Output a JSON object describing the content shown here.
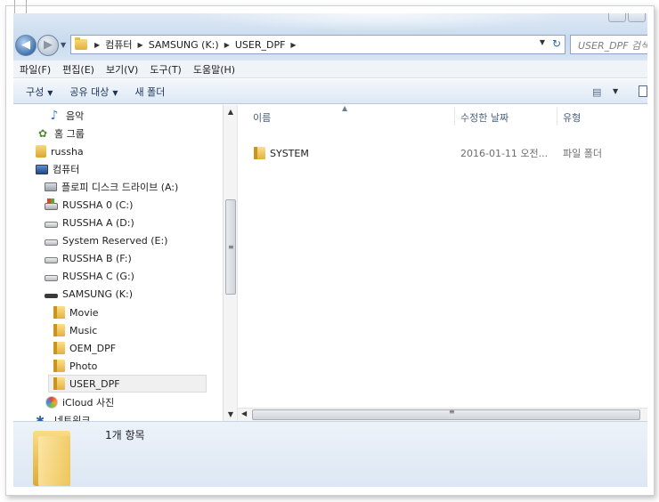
{
  "window": {
    "path": [
      "컴퓨터",
      "SAMSUNG (K:)",
      "USER_DPF"
    ],
    "search_placeholder": "USER_DPF 검색"
  },
  "nav_buttons": {
    "back": "◀",
    "forward": "▶",
    "refresh": "↻"
  },
  "menu": [
    "파일(F)",
    "편집(E)",
    "보기(V)",
    "도구(T)",
    "도움말(H)"
  ],
  "toolbar": {
    "organize": "구성",
    "share": "공유 대상",
    "new_folder": "새 폴더",
    "view_icon": "details-view-icon"
  },
  "nav_tree": [
    {
      "label": "음악",
      "icon": "music-icon"
    },
    {
      "label": "홈 그룹",
      "icon": "homegroup-icon"
    },
    {
      "label": "russha",
      "icon": "user-folder-icon"
    },
    {
      "label": "컴퓨터",
      "icon": "computer-icon"
    },
    {
      "label": "플로피 디스크 드라이브 (A:)",
      "icon": "floppy-drive-icon"
    },
    {
      "label": "RUSSHA 0 (C:)",
      "icon": "windows-drive-icon"
    },
    {
      "label": "RUSSHA A (D:)",
      "icon": "drive-icon"
    },
    {
      "label": "System Reserved (E:)",
      "icon": "drive-icon"
    },
    {
      "label": "RUSSHA B (F:)",
      "icon": "drive-icon"
    },
    {
      "label": "RUSSHA C (G:)",
      "icon": "drive-icon"
    },
    {
      "label": "SAMSUNG (K:)",
      "icon": "usb-drive-icon"
    },
    {
      "label": "Movie",
      "icon": "folder-icon"
    },
    {
      "label": "Music",
      "icon": "folder-icon"
    },
    {
      "label": "OEM_DPF",
      "icon": "folder-icon"
    },
    {
      "label": "Photo",
      "icon": "folder-icon"
    },
    {
      "label": "USER_DPF",
      "icon": "folder-icon",
      "selected": true
    },
    {
      "label": "iCloud 사진",
      "icon": "icloud-icon"
    },
    {
      "label": "네트워크",
      "icon": "network-icon"
    }
  ],
  "columns": [
    "이름",
    "수정한 날짜",
    "유형"
  ],
  "files": [
    {
      "name": "SYSTEM",
      "modified": "2016-01-11 오전...",
      "type": "파일 폴더"
    }
  ],
  "details": {
    "item_count": "1개 항목"
  }
}
